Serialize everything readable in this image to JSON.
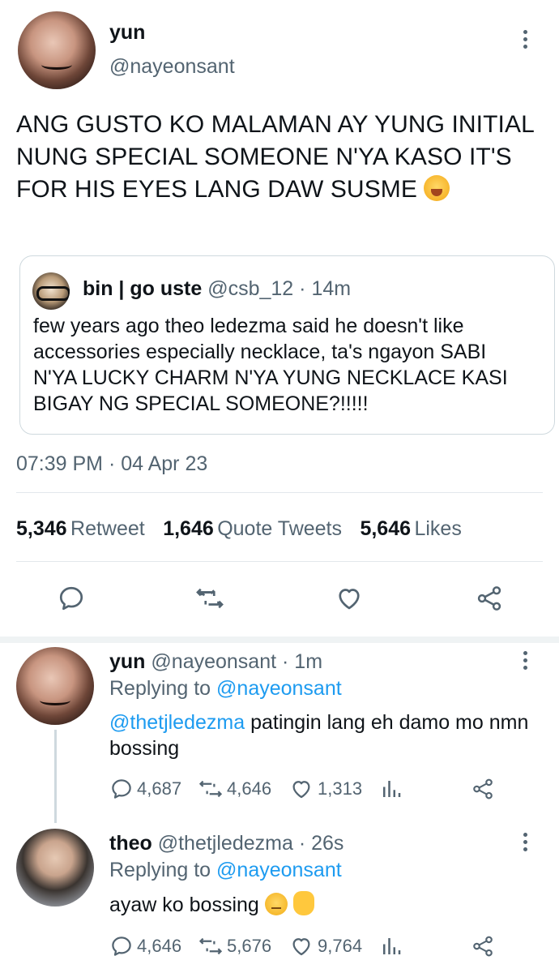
{
  "main_tweet": {
    "name": "yun",
    "handle": "@nayeonsant",
    "text": "ANG GUSTO KO MALAMAN AY YUNG INITIAL NUNG SPECIAL SOMEONE N'YA KASO IT'S FOR HIS EYES LANG DAW SUSME",
    "emoji": "loudly-crying-face",
    "timestamp": "07:39 PM · 04 Apr 23",
    "stats": {
      "retweets": "5,346",
      "retweets_label": "Retweet",
      "quotes": "1,646",
      "quotes_label": "Quote Tweets",
      "likes": "5,646",
      "likes_label": "Likes"
    }
  },
  "quoted_tweet": {
    "name": "bin | go uste",
    "handle": "@csb_12",
    "time": "· 14m",
    "text": "few years ago theo ledezma said he doesn't like accessories especially necklace, ta's ngayon SABI N'YA LUCKY CHARM N'YA YUNG NECKLACE KASI BIGAY NG SPECIAL SOMEONE?!!!!!"
  },
  "replies": [
    {
      "name": "yun",
      "handle": "@nayeonsant",
      "time": "· 1m",
      "replying_prefix": "Replying to",
      "replying_to": "@nayeonsant",
      "mention": "@thetjledezma",
      "text": "patingin lang eh damo mo nmn bossing",
      "replies": "4,687",
      "retweets": "4,646",
      "likes": "1,313"
    },
    {
      "name": "theo",
      "handle": "@thetjledezma",
      "time": "· 26s",
      "replying_prefix": "Replying to",
      "replying_to": "@nayeonsant",
      "text": "ayaw ko bossing",
      "emojis": [
        "expressionless-face",
        "raised-hand"
      ],
      "replies": "4,646",
      "retweets": "5,676",
      "likes": "9,764"
    }
  ],
  "colors": {
    "accent": "#1d9bf0",
    "text": "#0f1419",
    "secondary": "#536471",
    "border": "#cfd9de"
  }
}
